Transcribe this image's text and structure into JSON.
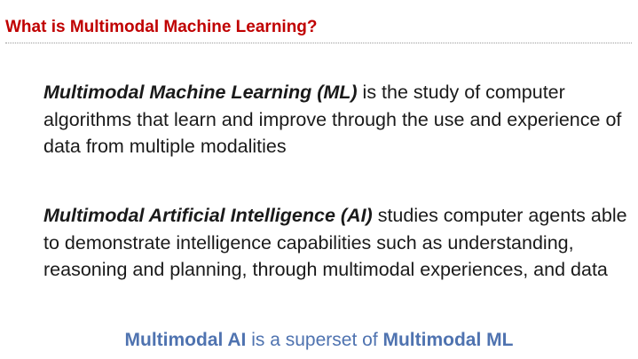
{
  "slide": {
    "title": "What is Multimodal Machine Learning?",
    "definitions": [
      {
        "term": "Multimodal Machine Learning (ML)",
        "text": " is the study of computer algorithms that learn and improve through the use and experience of data from multiple modalities"
      },
      {
        "term": "Multimodal Artificial Intelligence (AI)",
        "text": " studies computer agents able to demonstrate intelligence capabilities such as understanding, reasoning and planning, through multimodal experiences, and data"
      }
    ],
    "summary": {
      "part1": "Multimodal AI",
      "part2": " is a superset of ",
      "part3": "Multimodal ML"
    }
  },
  "colors": {
    "title": "#c00000",
    "summary": "#4f73b0",
    "body": "#1a1a1a"
  }
}
